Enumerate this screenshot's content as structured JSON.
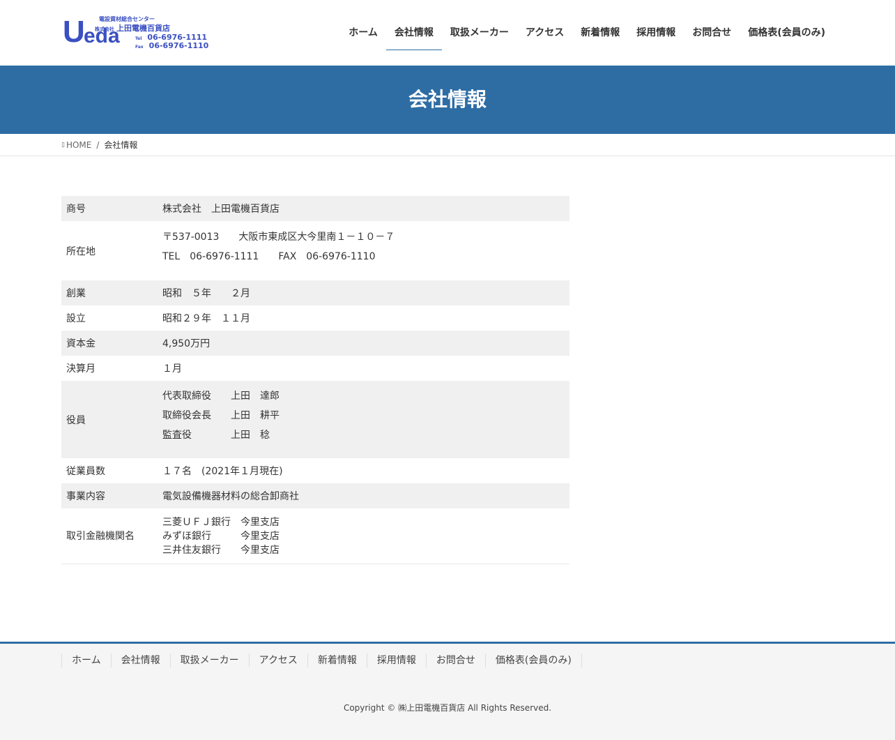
{
  "logo": {
    "mark_u": "U",
    "mark_eda": "eda",
    "tagline": "電設資材総合センター",
    "company_prefix": "株式会社",
    "company_name": "上田電機百貨店",
    "tel_label": "Tel",
    "tel": "06-6976-1111",
    "fax_label": "Fax",
    "fax": "06-6976-1110",
    "color": "#3a4fc1"
  },
  "nav": {
    "items": [
      {
        "label": "ホーム"
      },
      {
        "label": "会社情報"
      },
      {
        "label": "取扱メーカー"
      },
      {
        "label": "アクセス"
      },
      {
        "label": "新着情報"
      },
      {
        "label": "採用情報"
      },
      {
        "label": "お問合せ"
      },
      {
        "label": "価格表(会員のみ)"
      }
    ],
    "active": "会社情報"
  },
  "banner": {
    "title": "会社情報",
    "color": "#2e6da4"
  },
  "breadcrumb": {
    "home_icon": "home-icon",
    "home": "HOME",
    "separator": "/",
    "current": "会社情報"
  },
  "company_table": {
    "rows": [
      {
        "label": "商号",
        "lines": [
          "株式会社　上田電機百貨店"
        ]
      },
      {
        "label": "所在地",
        "lines": [
          "〒537-0013　　大阪市東成区大今里南１－１０－７",
          "TEL　06-6976-1111　　FAX　06-6976-1110"
        ]
      },
      {
        "label": "創業",
        "lines": [
          "昭和　５年　　２月"
        ]
      },
      {
        "label": "設立",
        "lines": [
          "昭和２９年　１１月"
        ]
      },
      {
        "label": "資本金",
        "lines": [
          "4,950万円"
        ]
      },
      {
        "label": "決算月",
        "lines": [
          "１月"
        ]
      },
      {
        "label": "役員",
        "lines": [
          "代表取締役　　上田　達郎",
          "取締役会長　　上田　耕平",
          "監査役　　　　上田　稔"
        ]
      },
      {
        "label": "従業員数",
        "lines": [
          "１７名　(2021年１月現在)"
        ]
      },
      {
        "label": "事業内容",
        "lines": [
          "電気設備機器材料の総合卸商社"
        ]
      },
      {
        "label": "取引金融機関名",
        "lines": [
          "三菱ＵＦＪ銀行　今里支店",
          "みずほ銀行　　　今里支店",
          "三井住友銀行　　今里支店"
        ]
      }
    ]
  },
  "footer": {
    "nav": [
      "ホーム",
      "会社情報",
      "取扱メーカー",
      "アクセス",
      "新着情報",
      "採用情報",
      "お問合せ",
      "価格表(会員のみ)"
    ],
    "copyright": "Copyright © ㈱上田電機百貨店 All Rights Reserved."
  }
}
